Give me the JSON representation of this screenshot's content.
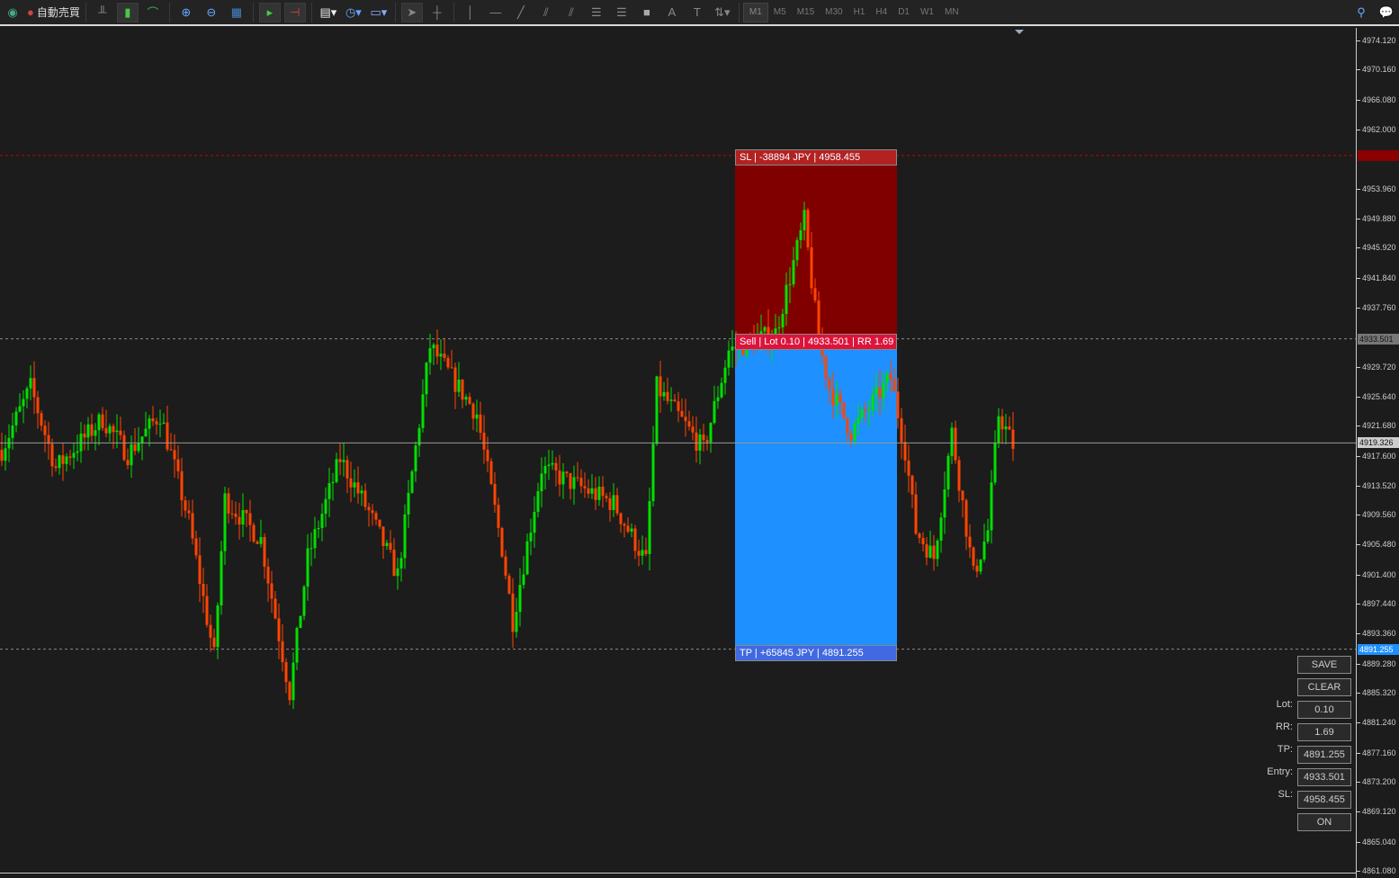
{
  "toolbar": {
    "auto_trading_label": "自動売買",
    "timeframes": [
      "M1",
      "M5",
      "M15",
      "M30",
      "H1",
      "H4",
      "D1",
      "W1",
      "MN"
    ],
    "active_timeframe": "M1"
  },
  "price_axis": {
    "max": 4974.12,
    "min": 4861.08,
    "labels": [
      "4974.120",
      "4970.160",
      "4966.080",
      "4962.000",
      "4953.960",
      "4949.880",
      "4945.920",
      "4941.840",
      "4937.760",
      "4929.720",
      "4925.640",
      "4921.680",
      "4917.600",
      "4913.520",
      "4909.560",
      "4905.480",
      "4901.400",
      "4897.440",
      "4893.360",
      "4889.280",
      "4885.320",
      "4881.240",
      "4877.160",
      "4873.200",
      "4869.120",
      "4865.040",
      "4861.080"
    ]
  },
  "levels": {
    "sl": {
      "price": 4958.455,
      "tag": "4958.455",
      "color": "#8b0000"
    },
    "entry": {
      "price": 4933.501,
      "tag": "4933.501"
    },
    "bid": {
      "price": 4919.326,
      "tag": "4919.326"
    },
    "tp": {
      "price": 4891.255,
      "tag": "4891.255",
      "color": "#1e90ff"
    }
  },
  "position": {
    "sl_label": "SL | -38894 JPY | 4958.455",
    "entry_label": "Sell | Lot 0.10 | 4933.501 | RR 1.69",
    "tp_label": "TP | +65845 JPY | 4891.255",
    "risk_color": "#800000",
    "reward_color": "#1e90ff"
  },
  "panel": {
    "save": "SAVE",
    "clear": "CLEAR",
    "lot_label": "Lot:",
    "lot": "0.10",
    "rr_label": "RR:",
    "rr": "1.69",
    "tp_label": "TP:",
    "tp": "4891.255",
    "entry_label": "Entry:",
    "entry": "4933.501",
    "sl_label": "SL:",
    "sl": "4958.455",
    "toggle": "ON"
  },
  "chart_data": {
    "type": "candlestick",
    "bull_color": "#00e000",
    "bear_color": "#ff4500",
    "path": [
      [
        0,
        4918.4
      ],
      [
        8,
        4926.9
      ],
      [
        15,
        4915.9
      ],
      [
        28,
        4922.6
      ],
      [
        35,
        4917.8
      ],
      [
        44,
        4923.3
      ],
      [
        52,
        4908.6
      ],
      [
        59,
        4890.2
      ],
      [
        62,
        4911.7
      ],
      [
        72,
        4906.2
      ],
      [
        80,
        4885.3
      ],
      [
        85,
        4903.7
      ],
      [
        94,
        4917.2
      ],
      [
        102,
        4909.9
      ],
      [
        110,
        4901.3
      ],
      [
        119,
        4932.5
      ],
      [
        132,
        4923.3
      ],
      [
        139,
        4905.0
      ],
      [
        142,
        4895.1
      ],
      [
        150,
        4915.9
      ],
      [
        160,
        4913.5
      ],
      [
        170,
        4911.1
      ],
      [
        179,
        4903.1
      ],
      [
        182,
        4926.9
      ],
      [
        195,
        4918.4
      ],
      [
        202,
        4931.9
      ],
      [
        215,
        4934.3
      ],
      [
        223,
        4949.6
      ],
      [
        227,
        4933.1
      ],
      [
        230,
        4926.9
      ],
      [
        236,
        4920.8
      ],
      [
        247,
        4928.2
      ],
      [
        251,
        4918.4
      ],
      [
        254,
        4907.4
      ],
      [
        259,
        4903.7
      ],
      [
        264,
        4920.8
      ],
      [
        270,
        4901.3
      ],
      [
        274,
        4907.4
      ],
      [
        277,
        4923.3
      ],
      [
        281,
        4919.0
      ]
    ]
  }
}
